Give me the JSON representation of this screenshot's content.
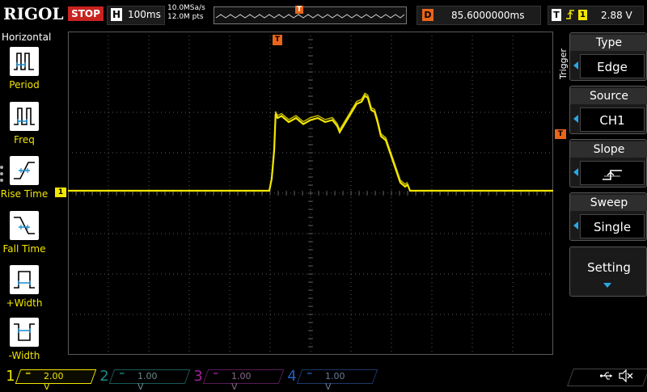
{
  "top": {
    "brand": "RIGOL",
    "run_state": "STOP",
    "horizontal_label": "H",
    "timebase": "100ms",
    "sample_rate": "10.0MSa/s",
    "memory_depth": "12.0M pts",
    "memory_marker": "T",
    "delay_label": "D",
    "delay_value": "85.6000000ms",
    "trigger_label": "T",
    "trigger_edge_icon": "rising-edge",
    "trigger_source_num": "1",
    "trigger_level": "2.88 V"
  },
  "left": {
    "title": "Horizontal",
    "items": [
      {
        "label": "Period",
        "icon": "period-icon"
      },
      {
        "label": "Freq",
        "icon": "freq-icon"
      },
      {
        "label": "Rise Time",
        "icon": "rise-time-icon"
      },
      {
        "label": "Fall Time",
        "icon": "fall-time-icon"
      },
      {
        "label": "+Width",
        "icon": "pos-width-icon"
      },
      {
        "label": "-Width",
        "icon": "neg-width-icon"
      }
    ]
  },
  "markers": {
    "ch1": "1",
    "trigger_pos": "T",
    "trigger_level": "T"
  },
  "menu": {
    "side_title": "Trigger",
    "type_title": "Type",
    "type_value": "Edge",
    "source_title": "Source",
    "source_value": "CH1",
    "slope_title": "Slope",
    "slope_value_icon": "rising-slope-icon",
    "sweep_title": "Sweep",
    "sweep_value": "Single",
    "setting_title": "Setting"
  },
  "channels": [
    {
      "num": "1",
      "scale": "2.00 V",
      "color": "#f2e600",
      "active": true
    },
    {
      "num": "2",
      "scale": "1.00 V",
      "color": "#1a8a8a",
      "active": false
    },
    {
      "num": "3",
      "scale": "1.00 V",
      "color": "#a0209a",
      "active": false
    },
    {
      "num": "4",
      "scale": "1.00 V",
      "color": "#1f5fbf",
      "active": false
    }
  ],
  "colors": {
    "ch1": "#f2e600",
    "trigger": "#e8651a",
    "stop": "#c8231f",
    "menu_accent": "#29a8e8",
    "grid": "#5a5a5a"
  },
  "waveform": {
    "description_hidden": false,
    "baseline_div": 0,
    "points": [
      [
        0.0,
        0.0
      ],
      [
        4.15,
        0.0
      ],
      [
        4.2,
        0.3
      ],
      [
        4.25,
        1.0
      ],
      [
        4.28,
        1.9
      ],
      [
        4.32,
        1.8
      ],
      [
        4.4,
        1.85
      ],
      [
        4.55,
        1.7
      ],
      [
        4.7,
        1.8
      ],
      [
        4.85,
        1.65
      ],
      [
        5.0,
        1.75
      ],
      [
        5.15,
        1.8
      ],
      [
        5.3,
        1.7
      ],
      [
        5.45,
        1.75
      ],
      [
        5.55,
        1.6
      ],
      [
        5.6,
        1.45
      ],
      [
        5.65,
        1.55
      ],
      [
        5.75,
        1.75
      ],
      [
        5.85,
        1.95
      ],
      [
        5.95,
        2.15
      ],
      [
        6.05,
        2.2
      ],
      [
        6.12,
        2.35
      ],
      [
        6.18,
        2.3
      ],
      [
        6.25,
        2.0
      ],
      [
        6.32,
        1.95
      ],
      [
        6.38,
        1.7
      ],
      [
        6.45,
        1.35
      ],
      [
        6.55,
        1.25
      ],
      [
        6.65,
        0.9
      ],
      [
        6.75,
        0.55
      ],
      [
        6.85,
        0.2
      ],
      [
        6.95,
        0.1
      ],
      [
        7.0,
        0.15
      ],
      [
        7.05,
        0.0
      ],
      [
        10.0,
        0.0
      ]
    ]
  }
}
